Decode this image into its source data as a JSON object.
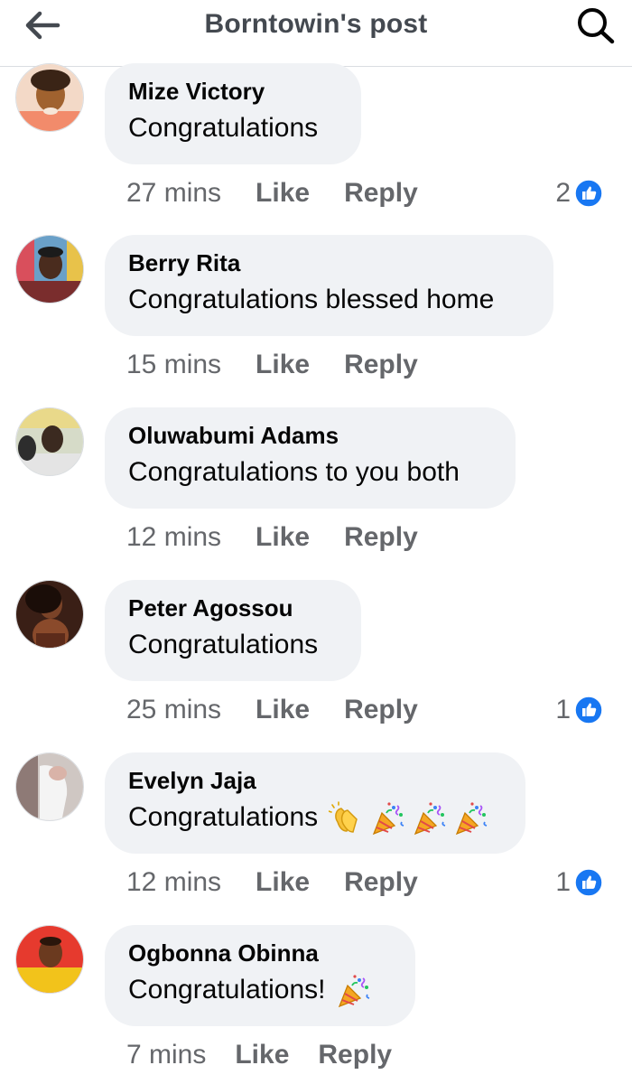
{
  "header": {
    "title": "Borntowin's post"
  },
  "colors": {
    "accent": "#1877f2",
    "bubble": "#f0f2f5",
    "meta": "#65676b"
  },
  "comments": [
    {
      "author": "Mize Victory",
      "text": "Congratulations",
      "time": "27 mins",
      "like": "Like",
      "reply": "Reply",
      "reactions": "2",
      "emojis": []
    },
    {
      "author": "Berry Rita",
      "text": "Congratulations blessed home",
      "time": "15 mins",
      "like": "Like",
      "reply": "Reply",
      "reactions": null,
      "emojis": []
    },
    {
      "author": "Oluwabumi Adams",
      "text": "Congratulations to you both",
      "time": "12 mins",
      "like": "Like",
      "reply": "Reply",
      "reactions": null,
      "emojis": []
    },
    {
      "author": "Peter Agossou",
      "text": "Congratulations",
      "time": "25 mins",
      "like": "Like",
      "reply": "Reply",
      "reactions": "1",
      "emojis": []
    },
    {
      "author": "Evelyn Jaja",
      "text": "Congratulations",
      "time": "12 mins",
      "like": "Like",
      "reply": "Reply",
      "reactions": "1",
      "emojis": [
        "clapping-hands-icon",
        "party-popper-icon",
        "party-popper-icon",
        "party-popper-icon"
      ]
    },
    {
      "author": "Ogbonna Obinna",
      "text": "Congratulations!",
      "time": "7 mins",
      "like": "Like",
      "reply": "Reply",
      "reactions": null,
      "emojis": [
        "party-popper-icon"
      ]
    }
  ]
}
